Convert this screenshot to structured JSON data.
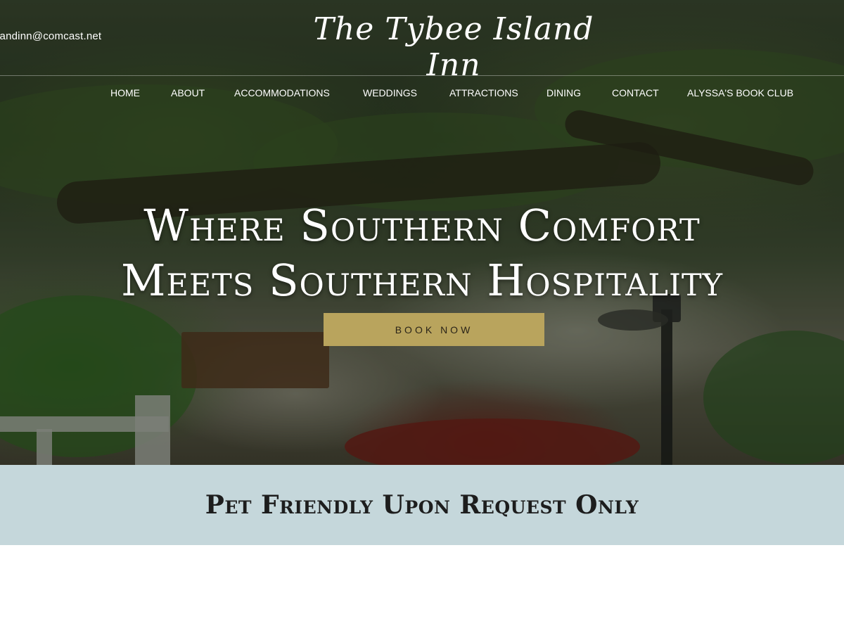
{
  "header": {
    "email": "landinn@comcast.net",
    "logo_text": "The Tybee Island Inn"
  },
  "nav": {
    "items": [
      {
        "label": "HOME"
      },
      {
        "label": "ABOUT"
      },
      {
        "label": "ACCOMMODATIONS"
      },
      {
        "label": "WEDDINGS"
      },
      {
        "label": "ATTRACTIONS"
      },
      {
        "label": "DINING"
      },
      {
        "label": "CONTACT"
      },
      {
        "label": "ALYSSA'S BOOK CLUB"
      }
    ]
  },
  "hero": {
    "headline_line1": "Where Southern Comfort",
    "headline_line2": "Meets Southern Hospitality",
    "button_label": "BOOK NOW"
  },
  "banner": {
    "text": "Pet Friendly Upon Request Only"
  },
  "colors": {
    "button_bg": "#b9a45d",
    "banner_bg": "#c5d7db"
  }
}
